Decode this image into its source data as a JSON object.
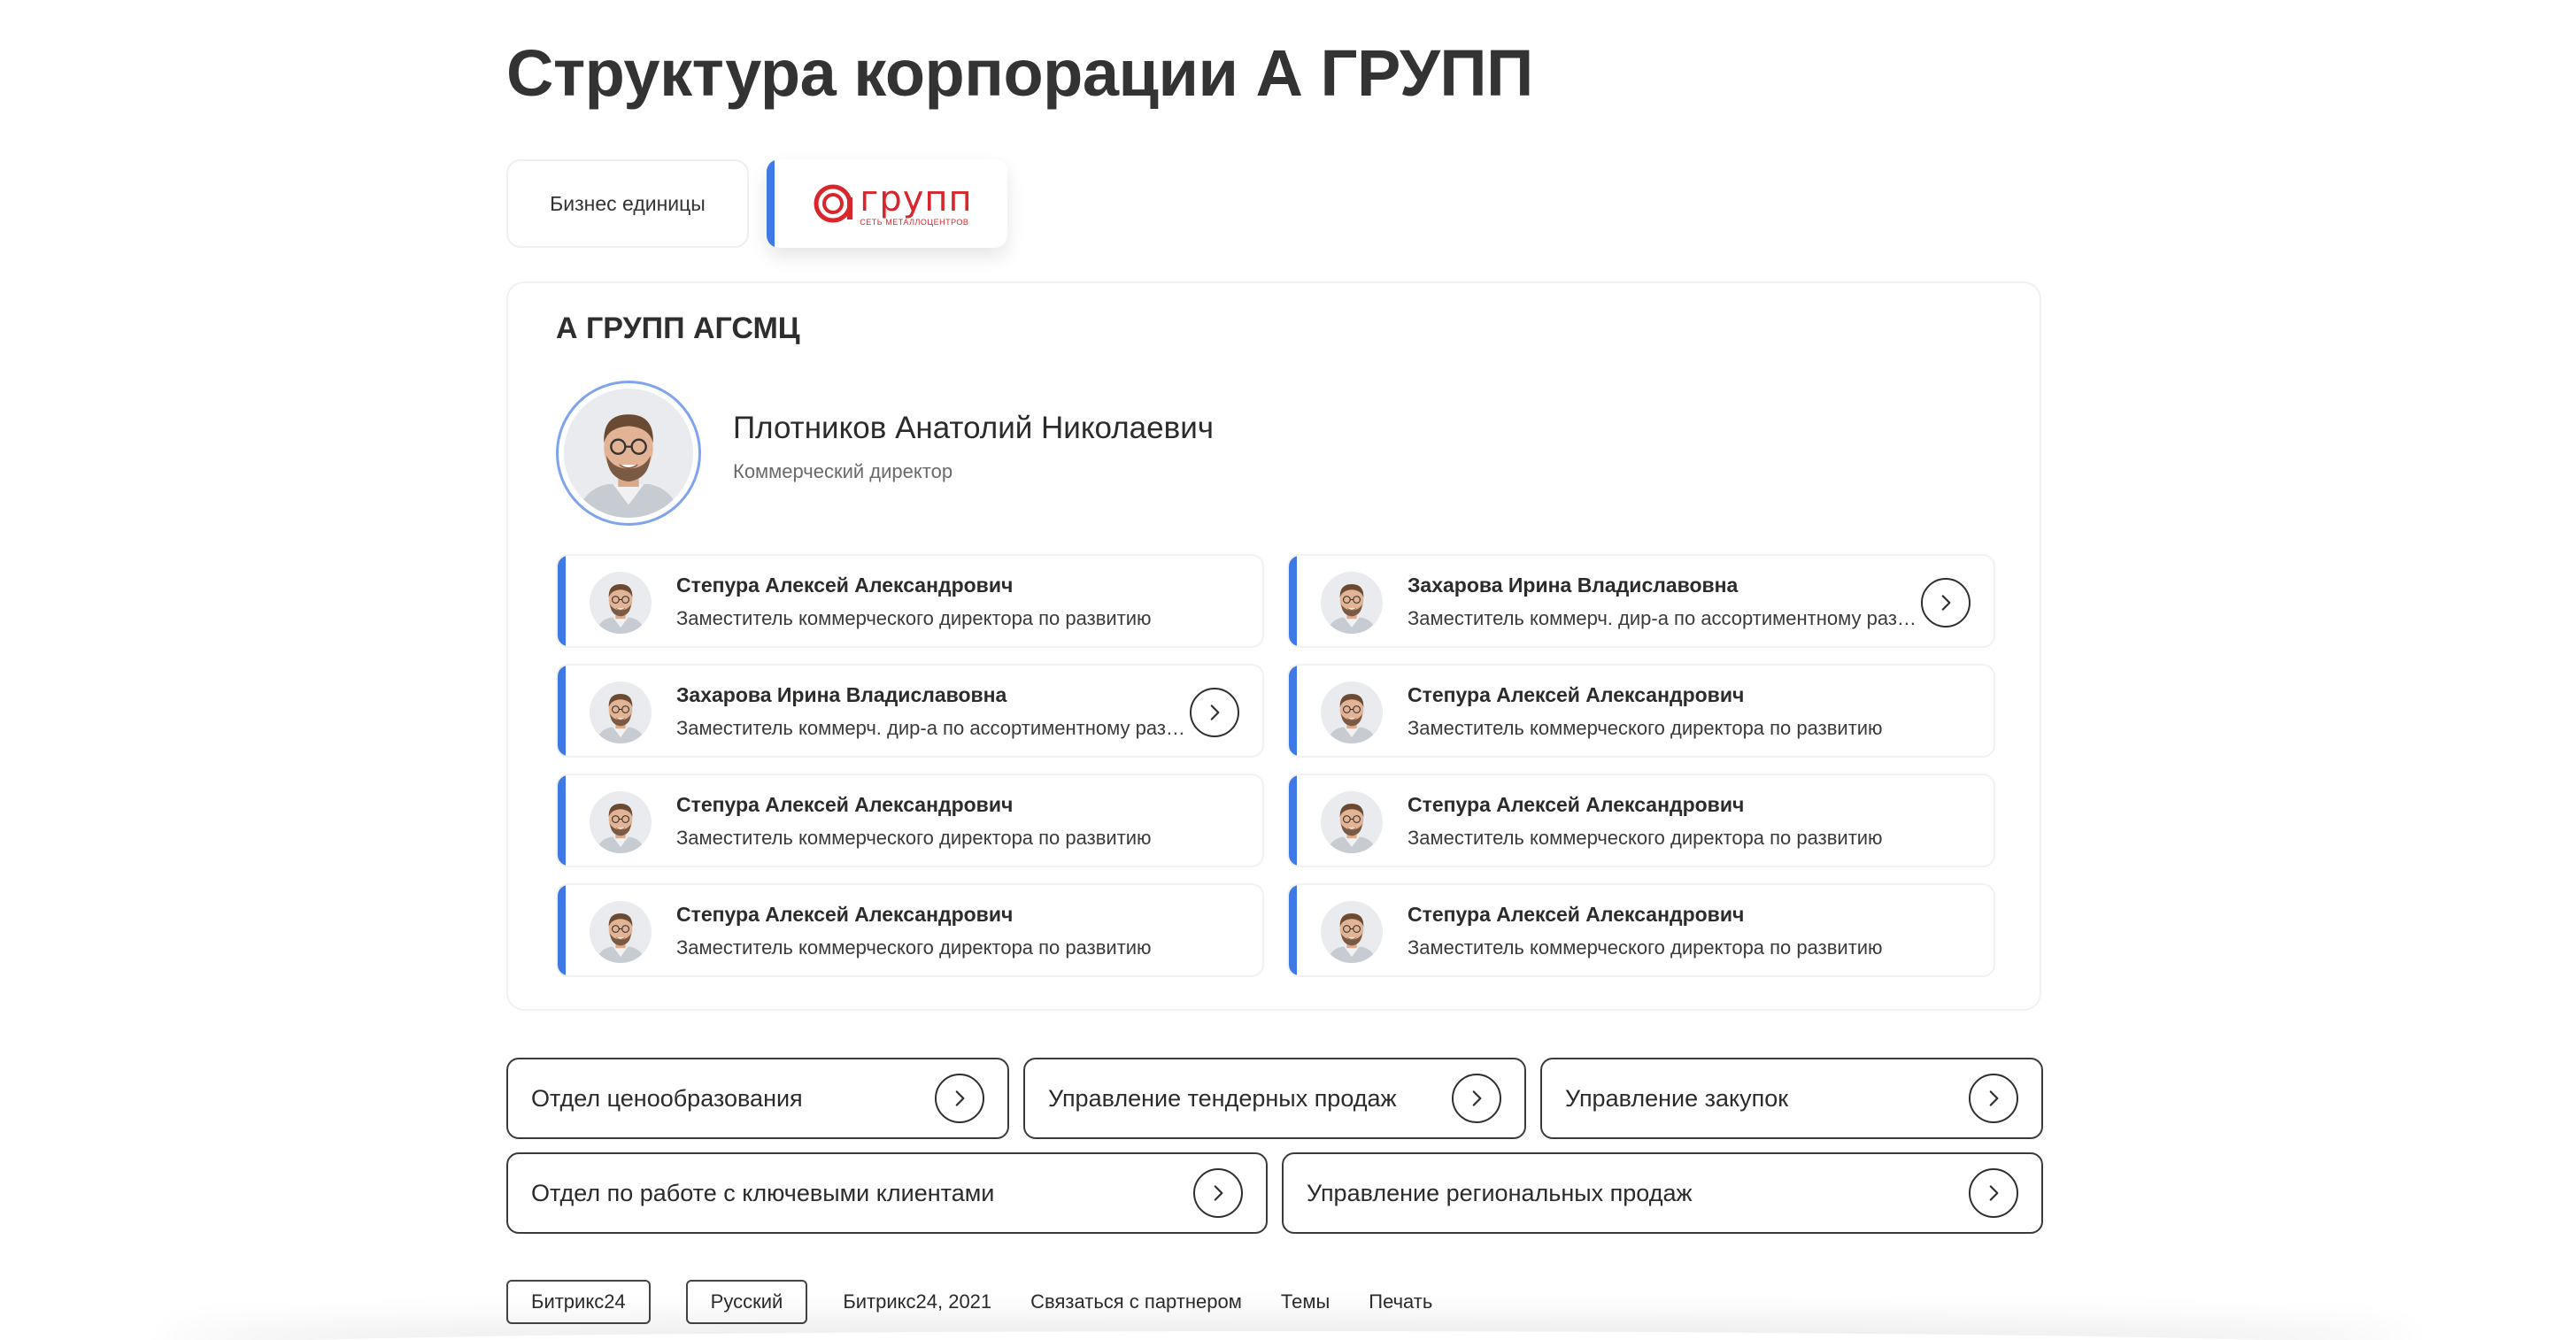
{
  "page": {
    "title": "Структура корпорации А ГРУПП"
  },
  "tabs": [
    {
      "label": "Бизнес единицы"
    },
    {
      "logo_main": "групп",
      "logo_sub": "СЕТЬ МЕТАЛЛОЦЕНТРОВ"
    }
  ],
  "unit": {
    "title": "А ГРУПП АГСМЦ",
    "head": {
      "name": "Плотников Анатолий Николаевич",
      "role": "Коммерческий директор"
    },
    "employees": [
      {
        "name": "Степура Алексей Александрович",
        "role": "Заместитель коммерческого директора по развитию"
      },
      {
        "name": "Захарова Ирина Владиславовна",
        "role": "Заместитель коммерч. дир-а по ассортиментному развитию"
      },
      {
        "name": "Захарова Ирина Владиславовна",
        "role": "Заместитель коммерч. дир-а по ассортиментному развитию"
      },
      {
        "name": "Степура Алексей Александрович",
        "role": "Заместитель коммерческого директора по развитию"
      },
      {
        "name": "Степура Алексей Александрович",
        "role": "Заместитель коммерческого директора по развитию"
      },
      {
        "name": "Степура Алексей Александрович",
        "role": "Заместитель коммерческого директора по развитию"
      },
      {
        "name": "Степура Алексей Александрович",
        "role": "Заместитель коммерческого директора по развитию"
      },
      {
        "name": "Степура Алексей Александрович",
        "role": "Заместитель коммерческого директора по развитию"
      }
    ]
  },
  "departments": [
    {
      "label": "Отдел ценообразования"
    },
    {
      "label": "Управление тендерных продаж"
    },
    {
      "label": "Управление закупок"
    },
    {
      "label": "Отдел по работе с ключевыми клиентами"
    },
    {
      "label": "Управление региональных продаж"
    }
  ],
  "footer": {
    "buttons": [
      "Битрикс24",
      "Русский"
    ],
    "links": [
      "Битрикс24, 2021",
      "Связаться с партнером",
      "Темы",
      "Печать"
    ]
  },
  "colors": {
    "accent": "#3f79e6",
    "brand": "#d9262c"
  },
  "icons": {
    "arrow": "chevron-right-icon",
    "avatar": "avatar-icon"
  }
}
